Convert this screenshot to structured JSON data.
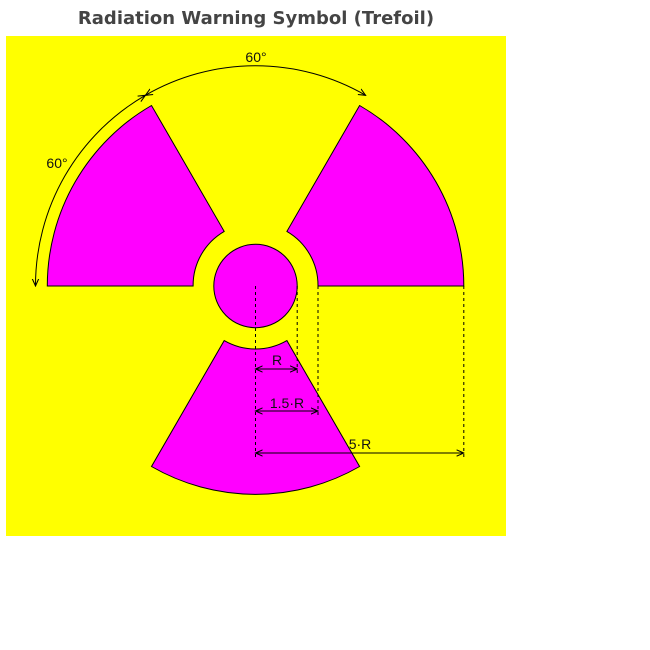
{
  "title": "Radiation Warning Symbol (Trefoil)",
  "colors": {
    "background": "#ffff00",
    "trefoil": "#ff00ff",
    "outline": "#000000"
  },
  "annotations": {
    "angle_top": "60°",
    "angle_left": "60°",
    "dim_r": "R",
    "dim_1_5r": "1.5·R",
    "dim_5r": "5·R"
  }
}
